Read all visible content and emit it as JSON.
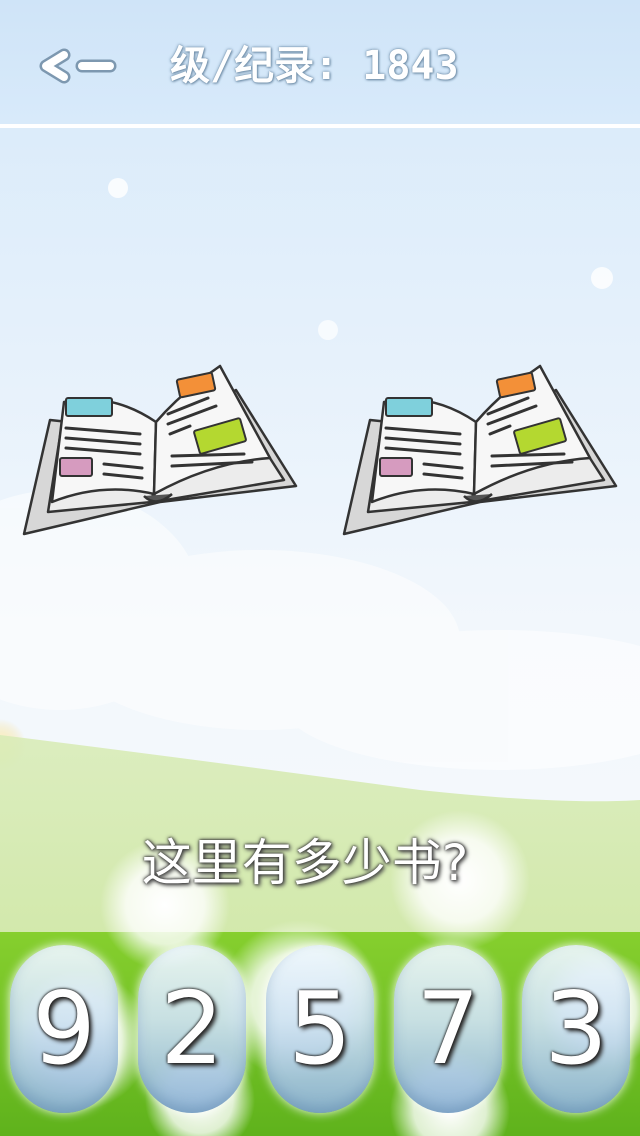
{
  "header": {
    "back_icon": "back-arrow-icon",
    "level_record_text": "级/纪录: 1843"
  },
  "scene": {
    "items": [
      {
        "icon": "open-book-icon"
      },
      {
        "icon": "open-book-icon"
      }
    ]
  },
  "question": "这里有多少书?",
  "answers": [
    {
      "label": "9"
    },
    {
      "label": "2"
    },
    {
      "label": "5"
    },
    {
      "label": "7"
    },
    {
      "label": "3"
    }
  ],
  "colors": {
    "sky_top": "#d4e8fa",
    "sky_bottom": "#f4f8fc",
    "grass": "#7ec92a",
    "book_cyan": "#7fd0dc",
    "book_orange": "#f39038",
    "book_green": "#b4d830",
    "book_pink": "#d69bbf"
  }
}
